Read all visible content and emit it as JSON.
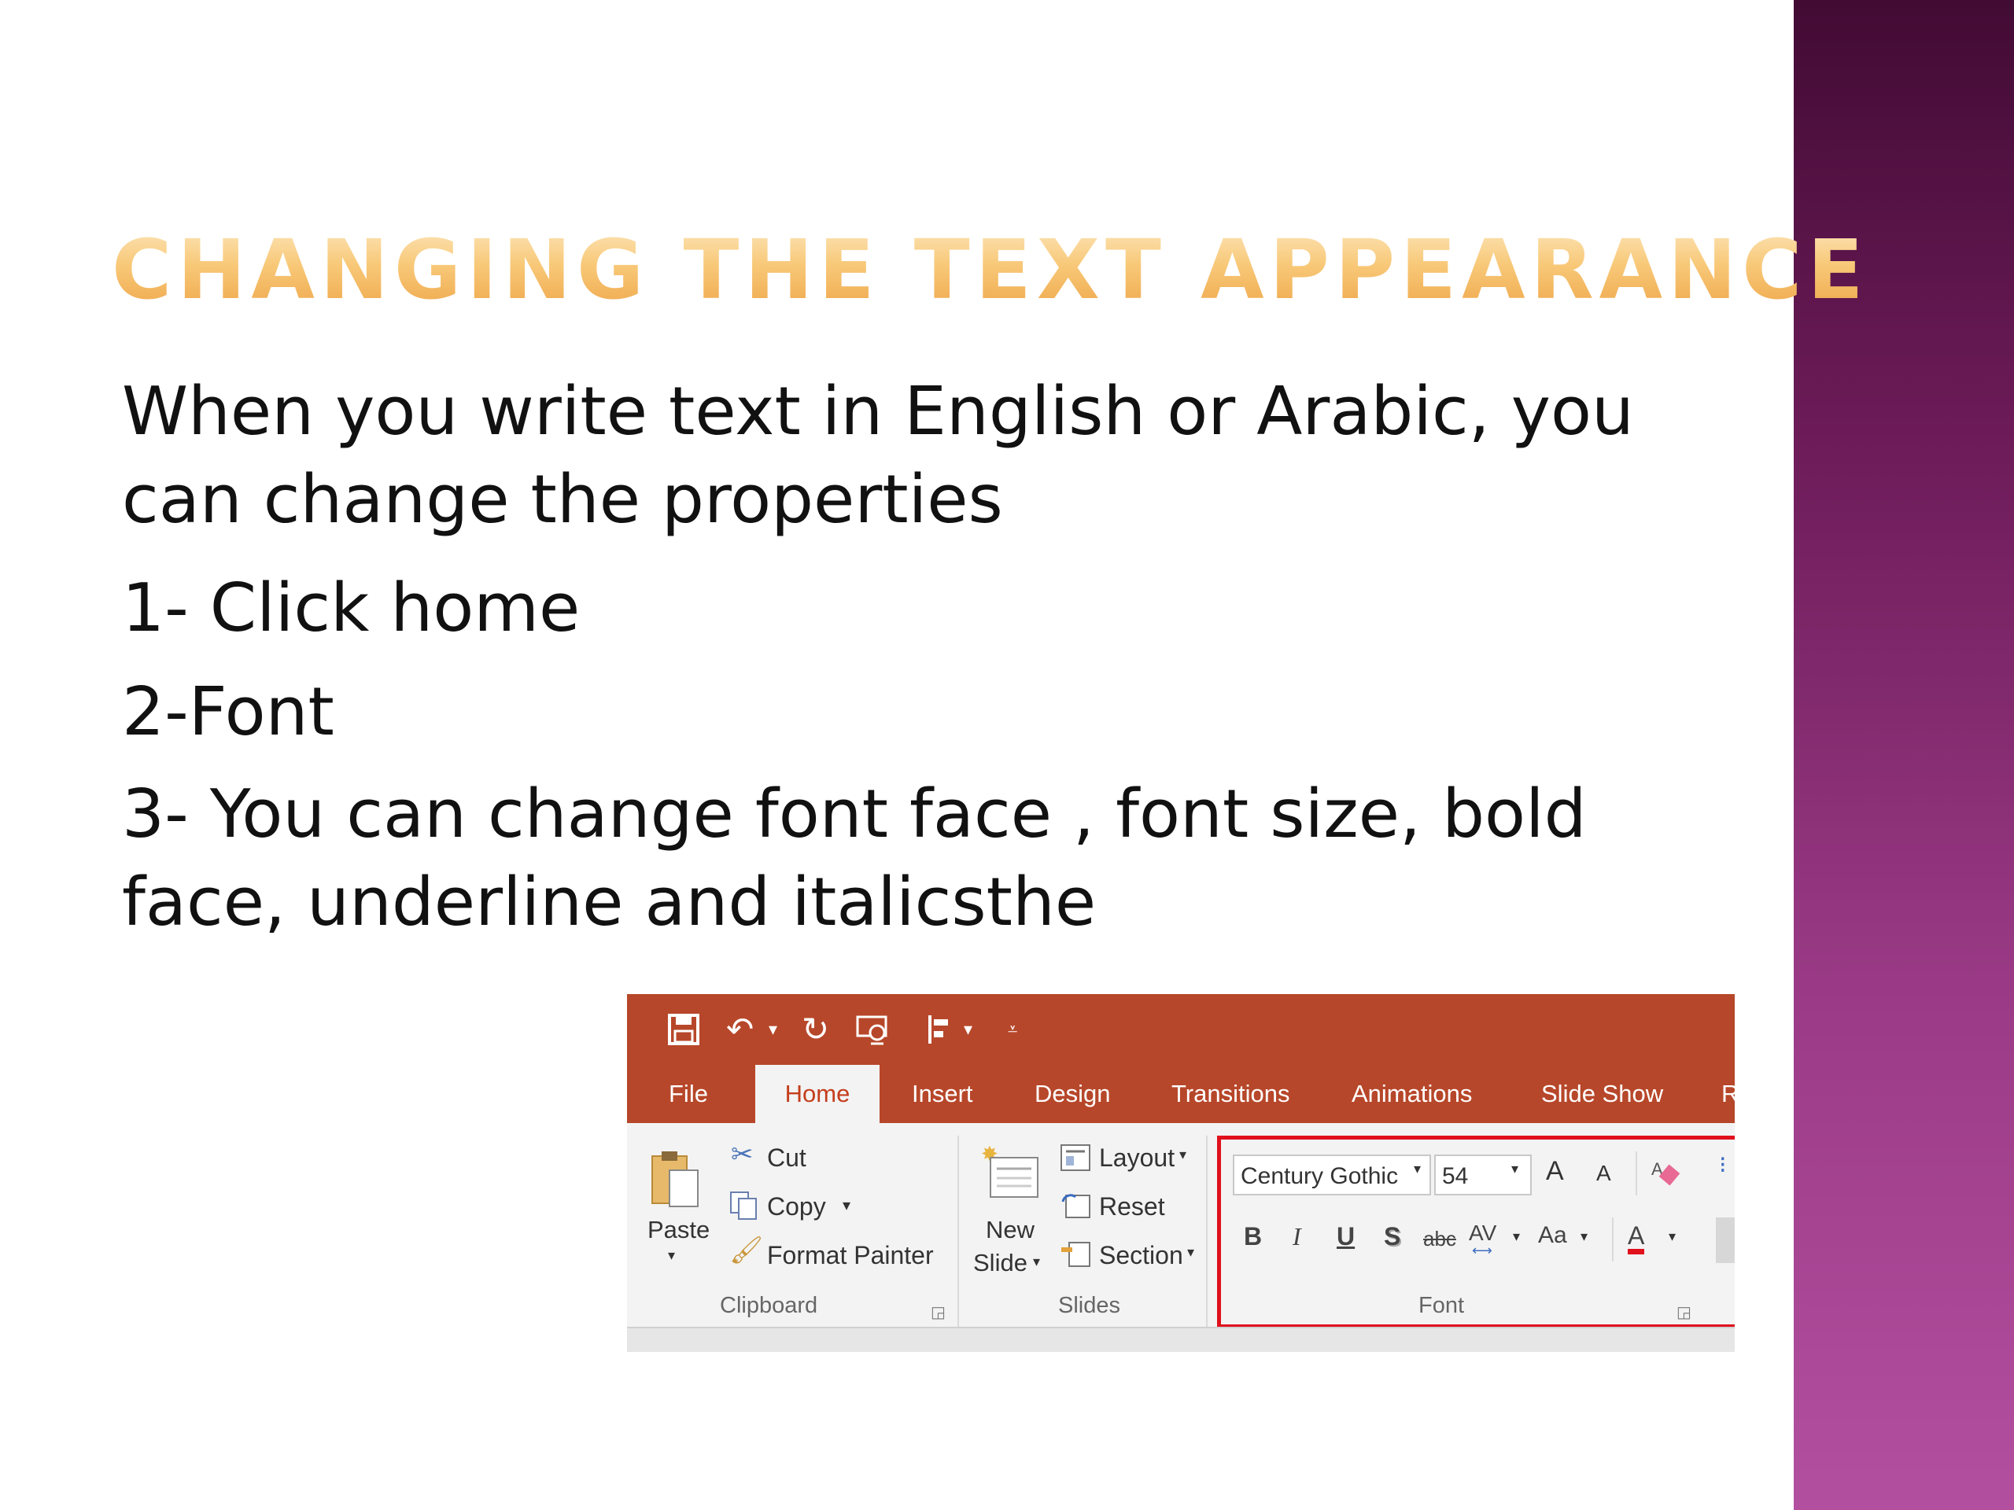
{
  "slide": {
    "title": "CHANGING THE TEXT APPEARANCE",
    "paragraphs": [
      "When you  write text in English or Arabic, you can change the properties",
      "1- Click home",
      "2-Font",
      "3- You can change font face , font size, bold face, underline and italicsthe"
    ],
    "accent_band_colors": [
      "#420b34",
      "#b34f9f"
    ],
    "title_color": "#f2b75e"
  },
  "ribbon": {
    "accent_color": "#b7472a",
    "tabs": [
      "File",
      "Home",
      "Insert",
      "Design",
      "Transitions",
      "Animations",
      "Slide Show",
      "R"
    ],
    "active_tab": "Home",
    "clipboard": {
      "paste": "Paste",
      "cut": "Cut",
      "copy": "Copy",
      "format_painter": "Format Painter",
      "group_label": "Clipboard"
    },
    "slides": {
      "new_slide_line1": "New",
      "new_slide_line2": "Slide",
      "layout": "Layout",
      "reset": "Reset",
      "section": "Section",
      "group_label": "Slides"
    },
    "font": {
      "font_face": "Century Gothic",
      "font_size": "54",
      "group_label": "Font",
      "highlight_color": "#e0101c",
      "buttons": {
        "bold": "B",
        "italic": "I",
        "underline": "U",
        "shadow": "S",
        "strikethrough": "abc",
        "spacing": "AV",
        "change_case": "Aa",
        "font_color": "A",
        "grow": "A",
        "shrink": "A"
      }
    }
  }
}
